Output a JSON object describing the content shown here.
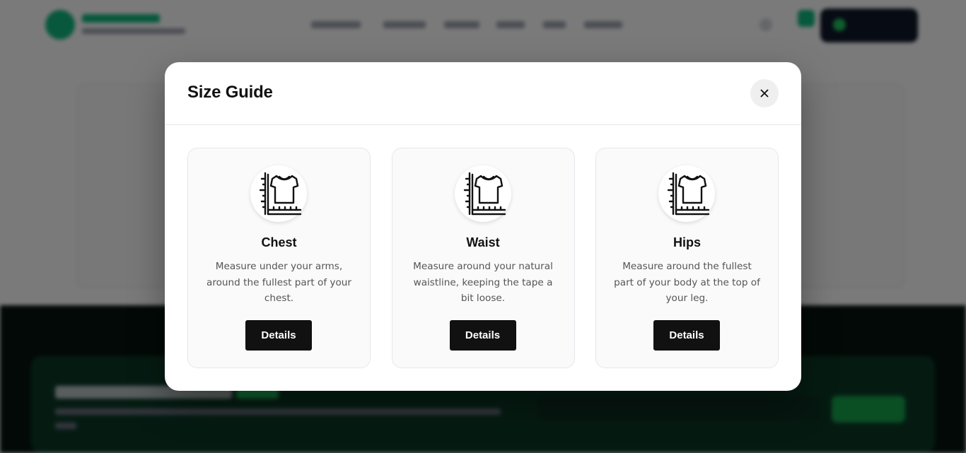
{
  "modal": {
    "title": "Size Guide",
    "close_icon": "close-icon"
  },
  "cards": [
    {
      "title": "Chest",
      "description": "Measure under your arms, around the fullest part of your chest.",
      "button_label": "Details",
      "icon": "size-chart-icon"
    },
    {
      "title": "Waist",
      "description": "Measure around your natural waistline, keeping the tape a bit loose.",
      "button_label": "Details",
      "icon": "size-chart-icon"
    },
    {
      "title": "Hips",
      "description": "Measure around the fullest part of your body at the top of your leg.",
      "button_label": "Details",
      "icon": "size-chart-icon"
    }
  ],
  "colors": {
    "overlay": "#000000",
    "button": "#111111",
    "card_bg": "#fafafa",
    "accent_green": "#10b981"
  }
}
